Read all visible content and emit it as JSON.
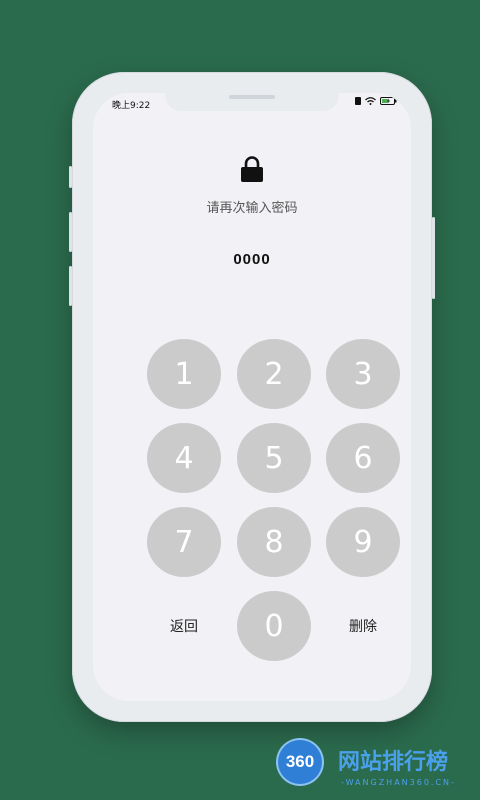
{
  "status_bar": {
    "time": "晚上9:22",
    "icons": [
      "signal-icon",
      "wifi-icon",
      "battery-charging-icon"
    ]
  },
  "lock_screen": {
    "icon": "lock-icon",
    "prompt": "请再次输入密码",
    "entered_code": "0000"
  },
  "keypad": {
    "keys": [
      "1",
      "2",
      "3",
      "4",
      "5",
      "6",
      "7",
      "8",
      "9",
      "0"
    ],
    "back_label": "返回",
    "delete_label": "删除"
  },
  "watermark": {
    "logo_text": "360",
    "title": "网站排行榜",
    "subtitle": "-WANGZHAN360.CN-"
  },
  "colors": {
    "background": "#2b6b4d",
    "screen": "#f2f2f6",
    "key": "#cbcbcb",
    "watermark_blue": "#4aa0ea"
  }
}
